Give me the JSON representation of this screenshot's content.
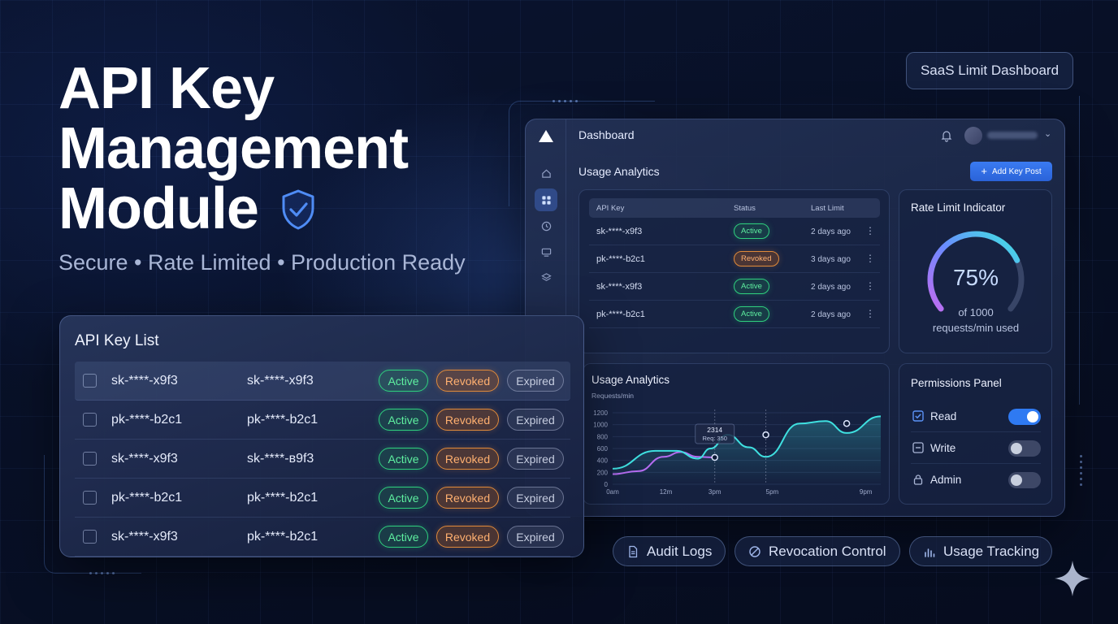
{
  "hero": {
    "title_lines": [
      "API Key",
      "Management",
      "Module"
    ],
    "subtitle": "Secure • Rate Limited • Production Ready"
  },
  "badge_top": "SaaS Limit Dashboard",
  "dashboard": {
    "header_title": "Dashboard",
    "section_title": "Usage Analytics",
    "add_button": "Add Key Post",
    "table": {
      "columns": [
        "API Key",
        "Status",
        "Last Limit"
      ],
      "rows": [
        {
          "key": "sk-****-x9f3",
          "status": "Active",
          "last": "2 days ago"
        },
        {
          "key": "pk-****-b2c1",
          "status": "Revoked",
          "last": "3 days ago"
        },
        {
          "key": "sk-****-x9f3",
          "status": "Active",
          "last": "2 days ago"
        },
        {
          "key": "pk-****-b2c1",
          "status": "Active",
          "last": "2 days ago"
        }
      ]
    },
    "rate_limit": {
      "title": "Rate Limit Indicator",
      "percent_label": "75%",
      "percent_value": 0.75,
      "sub_line1": "of 1000",
      "sub_line2": "requests/min used"
    },
    "usage_chart": {
      "title": "Usage Analytics",
      "unit_label": "Requests/min",
      "tooltip_value": "2314",
      "tooltip_label": "Req: 350"
    },
    "permissions": {
      "title": "Permissions Panel",
      "items": [
        {
          "label": "Read",
          "icon": "checkbox-checked-icon",
          "on": true
        },
        {
          "label": "Write",
          "icon": "checkbox-minus-icon",
          "on": false
        },
        {
          "label": "Admin",
          "icon": "lock-icon",
          "on": false
        }
      ]
    }
  },
  "key_list": {
    "title": "API Key List",
    "rows": [
      {
        "key1": "sk-****-x9f3",
        "key2": "sk-****-x9f3"
      },
      {
        "key1": "pk-****-b2c1",
        "key2": "pk-****-b2c1"
      },
      {
        "key1": "sk-****-x9f3",
        "key2": "sk-****-в9f3"
      },
      {
        "key1": "pk-****-b2c1",
        "key2": "pk-****-b2c1"
      },
      {
        "key1": "sk-****-x9f3",
        "key2": "pk-****-b2c1"
      }
    ],
    "badges": {
      "active": "Active",
      "revoked": "Revoked",
      "expired": "Expired"
    }
  },
  "chips": {
    "audit": "Audit Logs",
    "revocation": "Revocation Control",
    "usage": "Usage Tracking"
  },
  "colors": {
    "accent_blue": "#2f7af2",
    "active_green": "#2fd07e",
    "revoked_orange": "#e08a3a",
    "chart_cyan": "#3fe0e0",
    "chart_purple": "#b46cf0"
  },
  "chart_data": {
    "type": "line",
    "title": "Usage Analytics",
    "ylabel": "Requests/min",
    "xlabel": "",
    "x_ticks": [
      "0am",
      "12m",
      "3pm",
      "5pm",
      "9pm"
    ],
    "y_ticks": [
      0,
      200,
      400,
      600,
      800,
      1000,
      1200
    ],
    "ylim": [
      0,
      1200
    ],
    "grid": true,
    "series": [
      {
        "color": "#3fe0e0",
        "points": [
          [
            0,
            260
          ],
          [
            1,
            560
          ],
          [
            1.5,
            560
          ],
          [
            2,
            430
          ],
          [
            2.3,
            600
          ],
          [
            2.7,
            830
          ],
          [
            3.2,
            620
          ],
          [
            3.6,
            460
          ],
          [
            4.4,
            1020
          ],
          [
            5.0,
            1060
          ],
          [
            5.5,
            860
          ],
          [
            6.3,
            1140
          ]
        ]
      },
      {
        "color": "#b46cf0",
        "points": [
          [
            0,
            170
          ],
          [
            0.6,
            220
          ],
          [
            1.2,
            460
          ],
          [
            1.6,
            540
          ],
          [
            2.0,
            460
          ],
          [
            2.4,
            450
          ]
        ]
      }
    ],
    "markers": [
      [
        2.4,
        450
      ],
      [
        3.6,
        830
      ],
      [
        5.5,
        1020
      ]
    ],
    "annotation": {
      "x": 2.4,
      "text": "2314 / Req: 350"
    }
  }
}
